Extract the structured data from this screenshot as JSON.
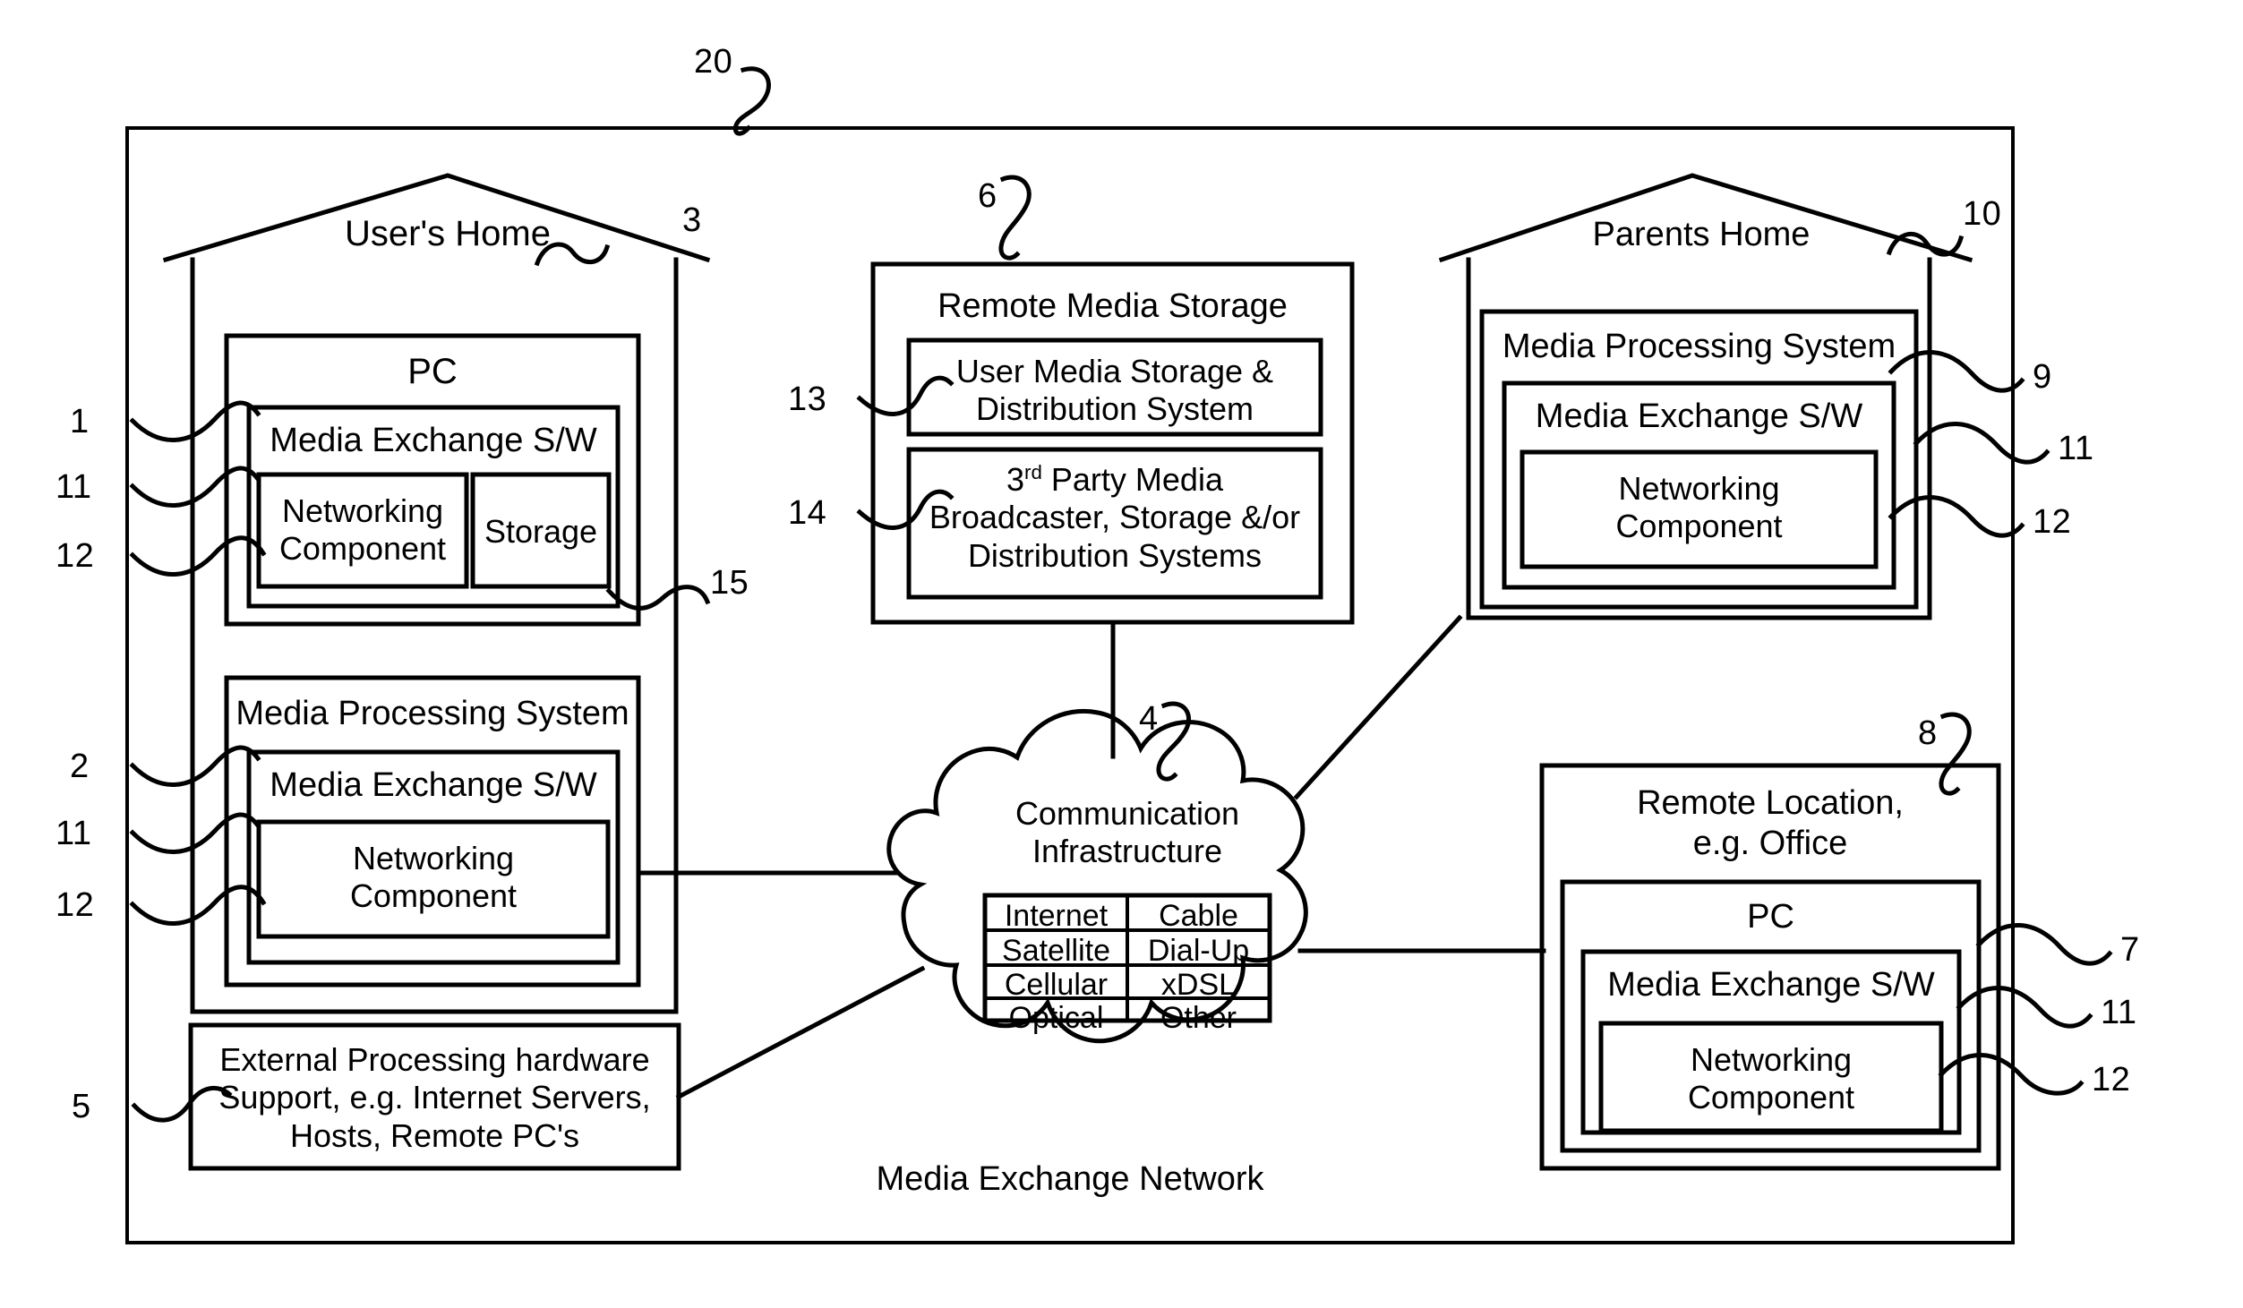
{
  "figure": {
    "outer_label": "Media Exchange Network",
    "outer_ref": "20"
  },
  "users_home": {
    "title": "User's Home",
    "ref": "3",
    "pc": {
      "title": "PC",
      "ref": "1",
      "mxsw": {
        "title": "Media Exchange S/W",
        "ref": "11",
        "networking_component": "Networking\nComponent",
        "networking_ref": "12",
        "storage": "Storage",
        "storage_ref": "15"
      }
    },
    "mps": {
      "title": "Media Processing System",
      "ref": "2",
      "mxsw": {
        "title": "Media Exchange S/W",
        "ref": "11",
        "networking_component": "Networking\nComponent",
        "networking_ref": "12"
      }
    }
  },
  "external_processing": {
    "ref": "5",
    "text": "External Processing hardware\nSupport, e.g. Internet Servers,\nHosts, Remote PC's"
  },
  "remote_media_storage": {
    "title": "Remote Media Storage",
    "ref": "6",
    "items": [
      {
        "ref": "13",
        "text": "User Media Storage &\nDistribution System",
        "sup": ""
      },
      {
        "ref": "14",
        "text_pre": "3",
        "sup": "rd",
        "text_post": " Party Media\nBroadcaster, Storage &/or\nDistribution Systems"
      }
    ]
  },
  "communication_infrastructure": {
    "title": "Communication\nInfrastructure",
    "ref": "4",
    "table": {
      "rows": [
        [
          "Internet",
          "Cable"
        ],
        [
          "Satellite",
          "Dial-Up"
        ],
        [
          "Cellular",
          "xDSL"
        ],
        [
          "Optical",
          "Other"
        ]
      ]
    }
  },
  "parents_home": {
    "title": "Parents Home",
    "ref": "10",
    "mps": {
      "title": "Media Processing System",
      "ref": "9",
      "mxsw": {
        "title": "Media Exchange S/W",
        "ref": "11",
        "networking_component": "Networking\nComponent",
        "networking_ref": "12"
      }
    }
  },
  "remote_location": {
    "title": "Remote Location,\ne.g. Office",
    "ref": "8",
    "pc": {
      "title": "PC",
      "ref": "7",
      "mxsw": {
        "title": "Media Exchange S/W",
        "ref": "11",
        "networking_component": "Networking\nComponent",
        "networking_ref": "12"
      }
    }
  },
  "colors": {
    "ink": "#000000",
    "paper": "#ffffff"
  }
}
